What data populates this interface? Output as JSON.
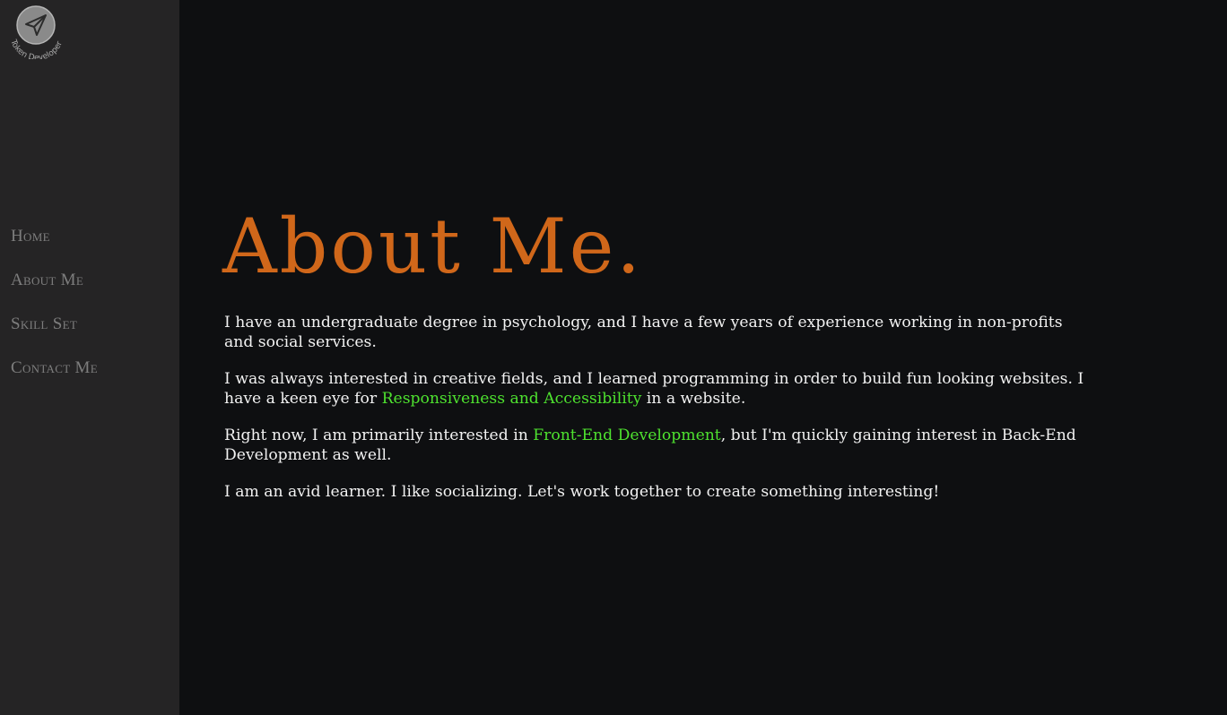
{
  "logo": {
    "text": "Token Developer",
    "icon": "paper-plane-icon"
  },
  "nav": {
    "items": [
      {
        "label": "Home"
      },
      {
        "label": "About Me"
      },
      {
        "label": "Skill Set"
      },
      {
        "label": "Contact Me"
      }
    ]
  },
  "page": {
    "title": "About Me.",
    "paragraphs": [
      {
        "text": "I have an undergraduate degree in psychology, and I have a few years of experience working in non-profits and social services."
      },
      {
        "before": "I was always interested in creative fields, and I learned programming in order to build fun looking websites. I have a keen eye for ",
        "highlight": "Responsiveness and Accessibility",
        "after": " in a website."
      },
      {
        "before": "Right now, I am primarily interested in ",
        "highlight": "Front-End Development",
        "after": ", but I'm quickly gaining interest in Back-End Development as well."
      },
      {
        "text": "I am an avid learner. I like socializing. Let's work together to create something interesting!"
      }
    ]
  },
  "colors": {
    "sidebar_bg": "#252425",
    "main_bg": "#0e0f11",
    "title": "#d0671a",
    "highlight": "#4ee22f",
    "nav_text": "#7d7d7d",
    "body_text": "#f2f2f2"
  }
}
